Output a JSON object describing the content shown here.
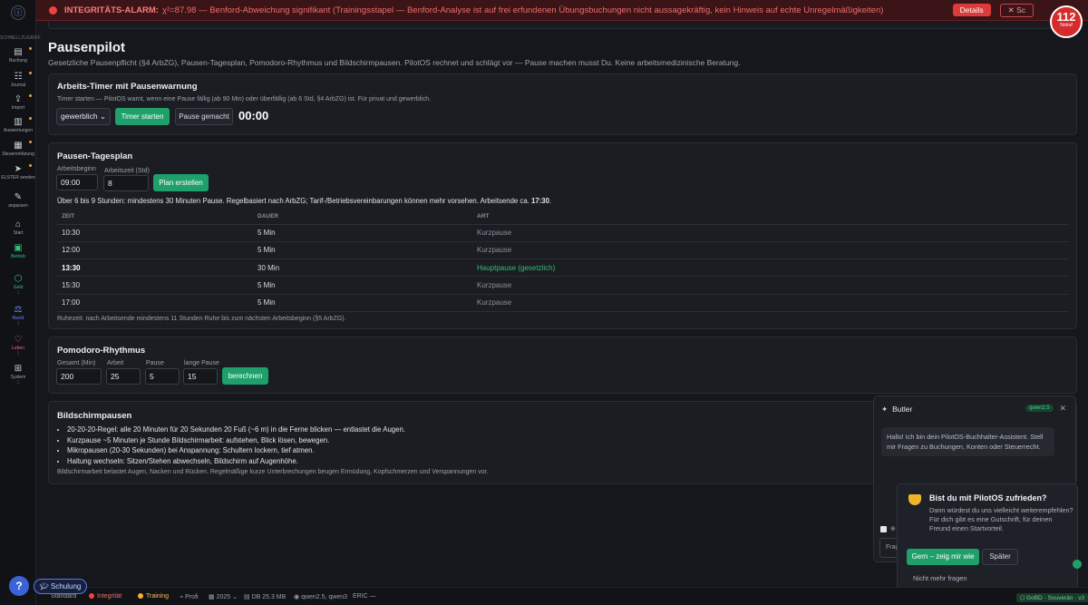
{
  "alarm": {
    "title": "INTEGRITÄTS-ALARM:",
    "text": "χ²=87.98 — Benford-Abweichung signifikant (Trainingsstapel — Benford-Analyse ist auf frei erfundenen Übungsbuchungen nicht aussagekräftig, kein Hinweis auf echte Unregelmäßigkeiten)",
    "details_label": "Details",
    "close_label": "✕ Sc"
  },
  "notfall": {
    "count": "112",
    "label": "Notruf"
  },
  "sidebar": {
    "caption": "SCHNELLZUGRIFF",
    "items": [
      {
        "icon": "▤",
        "label": "Buchung",
        "star": true
      },
      {
        "icon": "☷",
        "label": "Journal",
        "star": true
      },
      {
        "icon": "⇪",
        "label": "Import",
        "star": true
      },
      {
        "icon": "▥",
        "label": "Auswertungen",
        "star": true
      },
      {
        "icon": "▦",
        "label": "Steuererklärung",
        "star": true
      },
      {
        "icon": "➤",
        "label": "ELSTER senden",
        "star": true
      },
      {
        "icon": "✎",
        "label": "anpassen",
        "star": false
      }
    ],
    "sections": [
      {
        "icon": "⌂",
        "label": "Start",
        "sub": "",
        "color": ""
      },
      {
        "icon": "▣",
        "label": "Betrieb",
        "sub": "",
        "color": "green"
      },
      {
        "icon": "⬡",
        "label": "Geld",
        "sub": "1",
        "color": "green"
      },
      {
        "icon": "⚖",
        "label": "Recht",
        "sub": "1",
        "color": "blue"
      },
      {
        "icon": "♡",
        "label": "Leben",
        "sub": "1",
        "color": "red"
      },
      {
        "icon": "⊞",
        "label": "System",
        "sub": "1",
        "color": ""
      }
    ]
  },
  "page": {
    "title": "Pausenpilot",
    "intro": "Gesetzliche Pausenpflicht (§4 ArbZG), Pausen-Tagesplan, Pomodoro-Rhythmus und Bildschirmpausen. PilotOS rechnet und schlägt vor — Pause machen musst Du. Keine arbeitsmedizinische Beratung."
  },
  "timer": {
    "title": "Arbeits-Timer mit Pausenwarnung",
    "desc": "Timer starten — PilotOS warnt, wenn eine Pause fällig (ab 90 Min) oder überfällig (ab 6 Std, §4 ArbZG) ist. Für privat und gewerblich.",
    "mode": "gewerblich",
    "start_label": "Timer starten",
    "pause_label": "Pause gemacht",
    "time": "00:00"
  },
  "plan": {
    "title": "Pausen-Tagesplan",
    "start_label": "Arbeitsbeginn",
    "start_value": "09:00",
    "hours_label": "Arbeitszeit (Std)",
    "hours_value": "8",
    "create_label": "Plan erstellen",
    "summary": "Über 6 bis 9 Stunden: mindestens 30 Minuten Pause. Regelbasiert nach ArbZG; Tarif-/Betriebsvereinbarungen können mehr vorsehen. Arbeitsende ca.",
    "end_time": "17:30",
    "columns": [
      "ZEIT",
      "DAUER",
      "ART"
    ],
    "rows": [
      {
        "time": "10:30",
        "duration": "5 Min",
        "type": "Kurzpause",
        "main": false
      },
      {
        "time": "12:00",
        "duration": "5 Min",
        "type": "Kurzpause",
        "main": false
      },
      {
        "time": "13:30",
        "duration": "30 Min",
        "type": "Hauptpause (gesetzlich)",
        "main": true
      },
      {
        "time": "15:30",
        "duration": "5 Min",
        "type": "Kurzpause",
        "main": false
      },
      {
        "time": "17:00",
        "duration": "5 Min",
        "type": "Kurzpause",
        "main": false
      }
    ],
    "note": "Ruhezeit: nach Arbeitsende mindestens 11 Stunden Ruhe bis zum nächsten Arbeitsbeginn (§5 ArbZG)."
  },
  "pomodoro": {
    "title": "Pomodoro-Rhythmus",
    "fields": [
      {
        "label": "Gesamt (Min)",
        "value": "200"
      },
      {
        "label": "Arbeit",
        "value": "25"
      },
      {
        "label": "Pause",
        "value": "5"
      },
      {
        "label": "lange Pause",
        "value": "15"
      }
    ],
    "calc_label": "berechnen"
  },
  "screen": {
    "title": "Bildschirmpausen",
    "items": [
      "20-20-20-Regel: alle 20 Minuten für 20 Sekunden 20 Fuß (~6 m) in die Ferne blicken — entlastet die Augen.",
      "Kurzpause ~5 Minuten je Stunde Bildschirmarbeit: aufstehen, Blick lösen, bewegen.",
      "Mikropausen (20-30 Sekunden) bei Anspannung: Schultern lockern, tief atmen.",
      "Haltung wechseln: Sitzen/Stehen abwechseln, Bildschirm auf Augenhöhe."
    ],
    "note": "Bildschirmarbeit belastet Augen, Nacken und Rücken. Regelmäßige kurze Unterbrechungen beugen Ermüdung, Kopfschmerzen und Verspannungen vor."
  },
  "butler": {
    "title": "Butler",
    "model": "qwen2.5",
    "message": "Hallo! Ich bin dein PilotOS-Buchhalter-Assistent. Stell mir Fragen zu Buchungen, Konten oder Steuerrecht.",
    "input_prefix": "Frag",
    "check_prefix": "⊕"
  },
  "survey": {
    "title": "Bist du mit PilotOS zufrieden?",
    "body": "Dann würdest du uns vielleicht weiterempfehlen? Für dich gibt es eine Gutschrift, für deinen Freund einen Startvorteil.",
    "yes_label": "Gern – zeig mir wie",
    "later_label": "Später",
    "never_label": "Nicht mehr fragen"
  },
  "status": {
    "schulung": "Schulung",
    "standard": "Standard",
    "integritaet": "Integrität",
    "training": "Training",
    "profi": "Profi",
    "year": "2025 ⌄",
    "db": "DB 25.3 MB",
    "models": "qwen2.5, qwen3",
    "eric": "ERIC —",
    "right": "⬡ GoBD · Souverän · v3"
  },
  "colors": {
    "accent": "#1fa06b",
    "alarm": "#ef4444",
    "bg": "#15171c",
    "card": "#1b1d23"
  }
}
